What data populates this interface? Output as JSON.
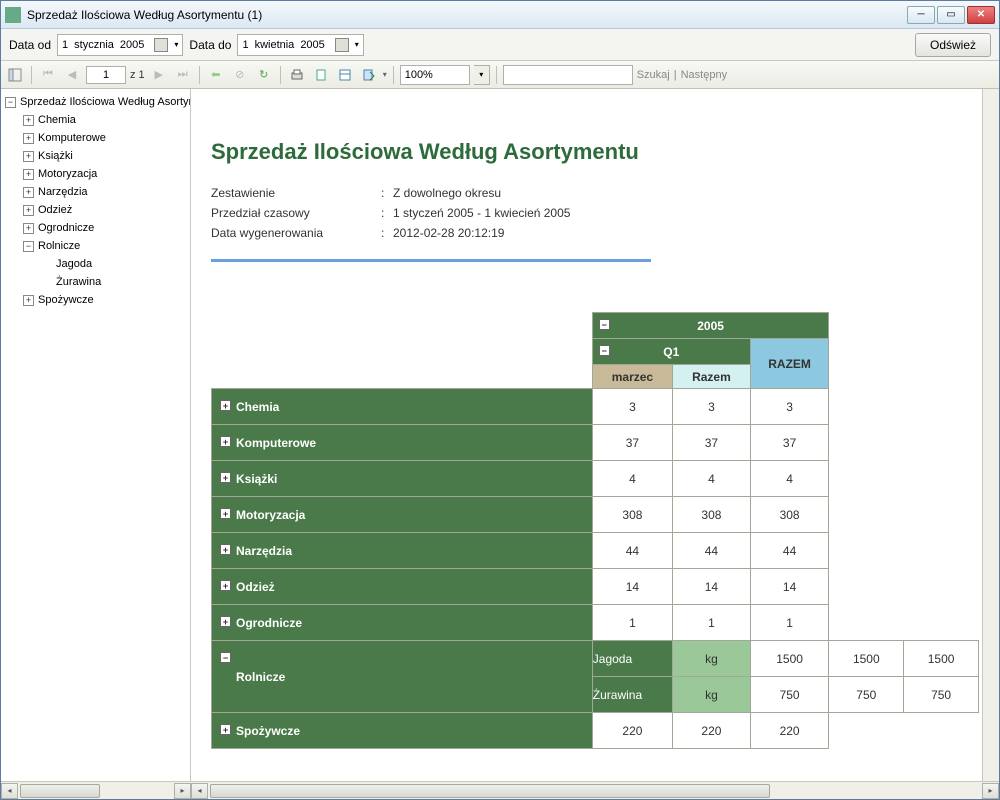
{
  "window": {
    "title": "Sprzedaż Ilościowa Według Asortymentu (1)"
  },
  "datebar": {
    "from_label": "Data od",
    "to_label": "Data do",
    "from_day": "1",
    "from_month": "stycznia",
    "from_year": "2005",
    "to_day": "1",
    "to_month": "kwietnia",
    "to_year": "2005",
    "refresh": "Odśwież"
  },
  "toolbar": {
    "page_current": "1",
    "page_of": "z 1",
    "zoom": "100%",
    "search_label": "Szukaj",
    "next_label": "Następny"
  },
  "tree": {
    "root": "Sprzedaż Ilościowa Według Asortymentu",
    "items": [
      {
        "label": "Chemia",
        "expanded": false
      },
      {
        "label": "Komputerowe",
        "expanded": false
      },
      {
        "label": "Książki",
        "expanded": false
      },
      {
        "label": "Motoryzacja",
        "expanded": false
      },
      {
        "label": "Narzędzia",
        "expanded": false
      },
      {
        "label": "Odzież",
        "expanded": false
      },
      {
        "label": "Ogrodnicze",
        "expanded": false
      },
      {
        "label": "Rolnicze",
        "expanded": true,
        "children": [
          {
            "label": "Jagoda"
          },
          {
            "label": "Żurawina"
          }
        ]
      },
      {
        "label": "Spożywcze",
        "expanded": false
      }
    ]
  },
  "report": {
    "title": "Sprzedaż Ilościowa Według Asortymentu",
    "meta": [
      {
        "label": "Zestawienie",
        "value": "Z dowolnego okresu"
      },
      {
        "label": "Przedział czasowy",
        "value": "1 styczeń 2005 - 1 kwiecień 2005"
      },
      {
        "label": "Data wygenerowania",
        "value": "2012-02-28 20:12:19"
      }
    ],
    "year": "2005",
    "quarter": "Q1",
    "col_month": "marzec",
    "col_sum": "Razem",
    "col_total": "RAZEM",
    "rows": [
      {
        "label": "Chemia",
        "vals": [
          "3",
          "3",
          "3"
        ]
      },
      {
        "label": "Komputerowe",
        "vals": [
          "37",
          "37",
          "37"
        ]
      },
      {
        "label": "Książki",
        "vals": [
          "4",
          "4",
          "4"
        ]
      },
      {
        "label": "Motoryzacja",
        "vals": [
          "308",
          "308",
          "308"
        ]
      },
      {
        "label": "Narzędzia",
        "vals": [
          "44",
          "44",
          "44"
        ]
      },
      {
        "label": "Odzież",
        "vals": [
          "14",
          "14",
          "14"
        ]
      },
      {
        "label": "Ogrodnicze",
        "vals": [
          "1",
          "1",
          "1"
        ]
      },
      {
        "label": "Rolnicze",
        "expanded": true,
        "children": [
          {
            "label": "Jagoda",
            "unit": "kg",
            "vals": [
              "1500",
              "1500",
              "1500"
            ]
          },
          {
            "label": "Żurawina",
            "unit": "kg",
            "vals": [
              "750",
              "750",
              "750"
            ]
          }
        ]
      },
      {
        "label": "Spożywcze",
        "vals": [
          "220",
          "220",
          "220"
        ]
      }
    ]
  }
}
